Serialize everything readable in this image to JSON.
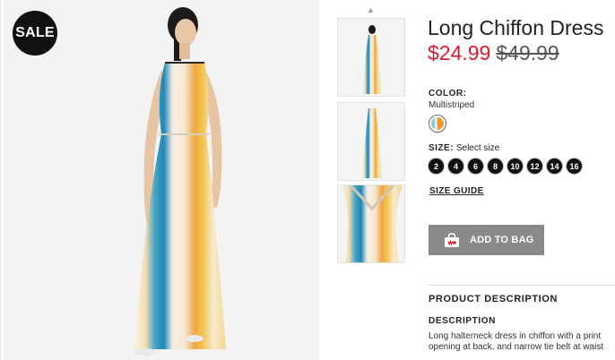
{
  "badge": {
    "label": "SALE"
  },
  "product": {
    "title": "Long Chiffon Dress",
    "price": "$24.99",
    "original_price": "$49.99"
  },
  "color": {
    "label": "COLOR:",
    "value": "Multistriped"
  },
  "size": {
    "label": "SIZE:",
    "prompt": "Select size",
    "options": [
      "2",
      "4",
      "6",
      "8",
      "10",
      "12",
      "14",
      "16"
    ]
  },
  "size_guide": "SIZE GUIDE",
  "add_to_bag": "ADD TO BAG",
  "product_description_heading": "PRODUCT DESCRIPTION",
  "description": {
    "heading": "DESCRIPTION",
    "lines": [
      "Long halterneck dress in chiffon with a print",
      "opening at back, and narrow tie belt at waist"
    ]
  },
  "icons": {
    "thumbnail_scroll": "chevron-up-icon",
    "bag": "shopping-bag-icon"
  },
  "colors": {
    "sale_price": "#e0182d",
    "button": "#8a8a8a",
    "badge": "#111111"
  }
}
